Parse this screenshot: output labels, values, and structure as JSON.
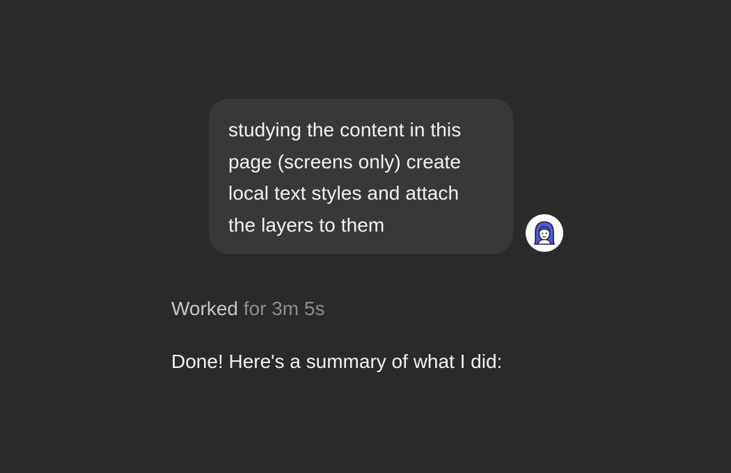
{
  "chat": {
    "user_message": {
      "text": "studying the content in this\npage (screens only) create\nlocal text styles and attach\nthe layers to them",
      "avatar_icon": "user-avatar-icon"
    },
    "status": {
      "worked_label": "Worked",
      "duration_text": "for 3m 5s"
    },
    "assistant_message": {
      "text": "Done! Here's a summary of what I did:"
    }
  },
  "colors": {
    "background": "#2a2a2a",
    "user_bubble": "#383838",
    "primary_text": "#f2f2f2",
    "secondary_text": "#c8c8c8",
    "muted_text": "#8e8e8e",
    "avatar_accent": "#4d5bd6"
  }
}
